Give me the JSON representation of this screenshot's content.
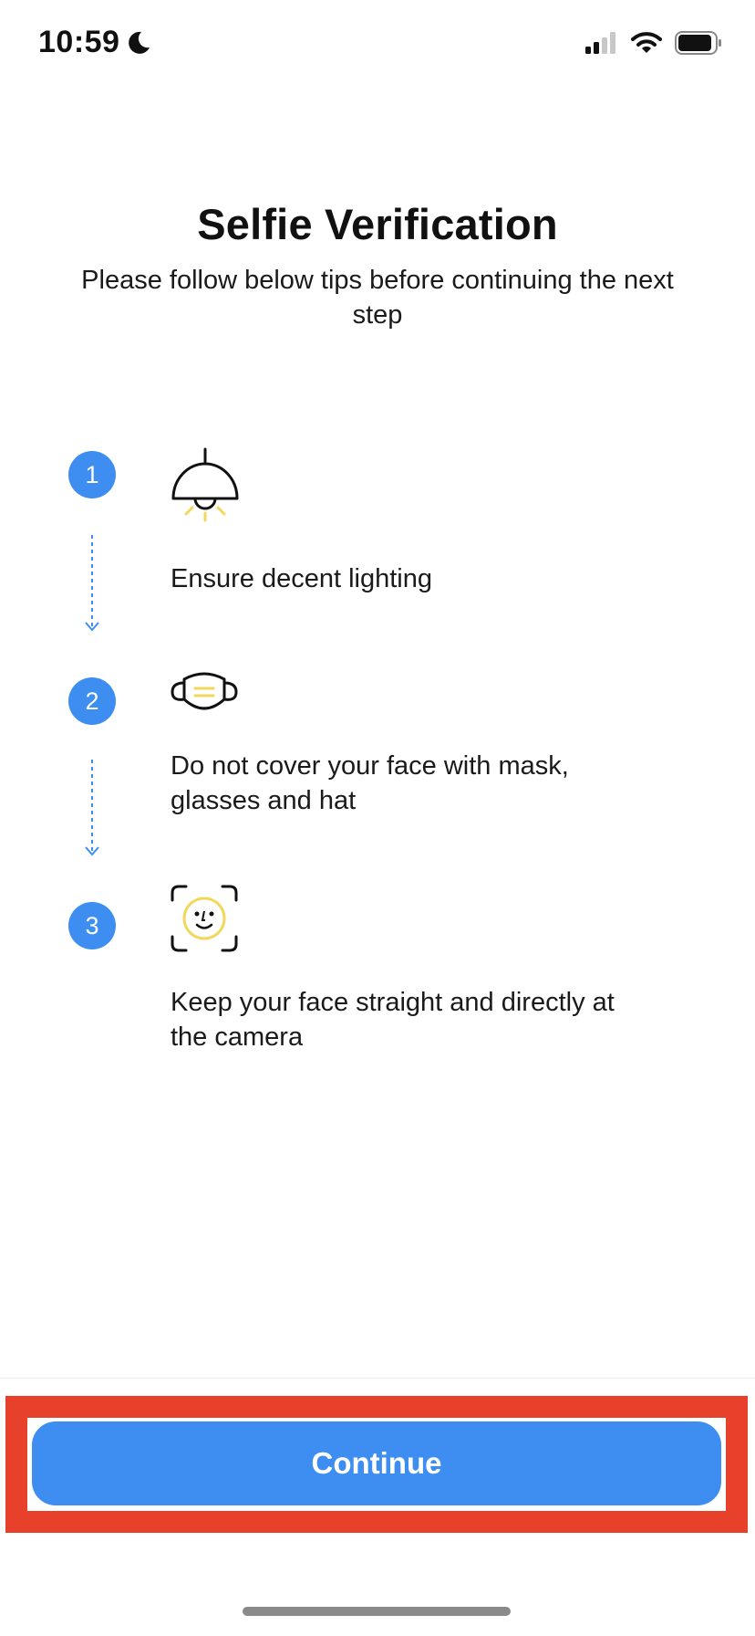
{
  "status_bar": {
    "time": "10:59",
    "icons": [
      "moon-icon",
      "cellular-signal-icon",
      "wifi-icon",
      "battery-icon"
    ]
  },
  "header": {
    "title": "Selfie Verification",
    "subtitle": "Please follow below tips before continuing the next step"
  },
  "steps": [
    {
      "number": "1",
      "icon": "lamp-icon",
      "text": "Ensure decent lighting"
    },
    {
      "number": "2",
      "icon": "face-mask-icon",
      "text": "Do not cover your face with mask, glasses and hat"
    },
    {
      "number": "3",
      "icon": "face-scan-icon",
      "text": "Keep your face straight and directly at the camera"
    }
  ],
  "footer": {
    "continue_label": "Continue"
  },
  "colors": {
    "accent": "#3d8ef0",
    "highlight": "#e8412b",
    "icon_yellow": "#f2d75c"
  }
}
